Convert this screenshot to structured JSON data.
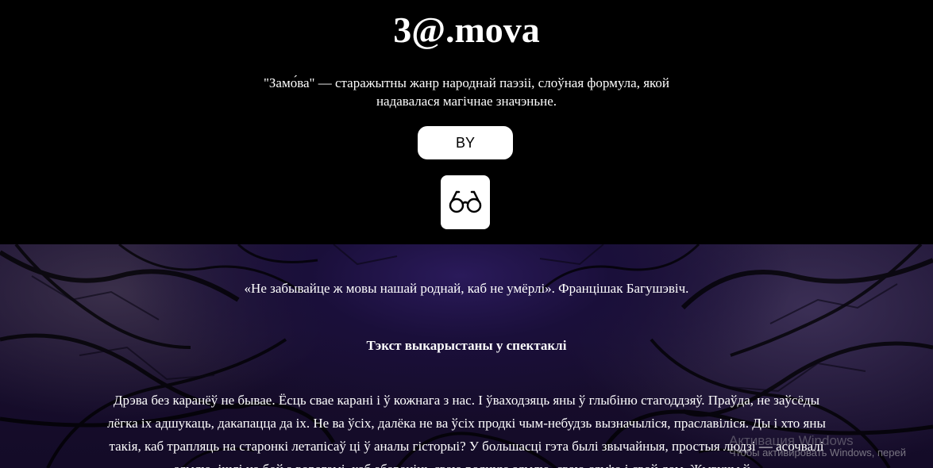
{
  "header": {
    "title": "3@.mova",
    "tagline_line1": "\"Замо́ва\" — старажытны жанр народнай паэзіі, слоўная формула, якой",
    "tagline_line2": "надавалася магічнае значэньне.",
    "lang_button_label": "BY",
    "glasses_icon": "glasses-icon"
  },
  "main": {
    "quote": "«Не забывайце ж мовы нашай роднай, каб не умёрлі». Францішак Багушэвіч.",
    "section_heading": "Тэкст выкарыстаны у спектаклі",
    "paragraph_lines": [
      "Дрэва без каранёў не бывае. Ёсць свае карані і ў кожнага з нас. І ўваходзяць яны ў глыбіню стагоддзяў. Праўда, не заўсёды",
      "лёгка іх адшукаць, дакапацца да іх. Не ва ўсіх, далёка не ва ўсіх продкі чым-небудзь вызначыліся, праславіліся. Ды і хто яны",
      "такія, каб трапляць на старонкі летапісаў ці ў аналы гісторыі? У большасці гэта былі звычайныя, простыя людзі — асочвалі",
      "зямлю, ішлі на бой з ворагамі, каб абараніць сваю родную зямлю, сваю сям'ю і свой дом. Жывучы ў..."
    ]
  },
  "system": {
    "watermark_title": "Активация Windows",
    "watermark_text": "Чтобы активировать Windows, перей"
  },
  "colors": {
    "background": "#000000",
    "button_bg": "#ffffff",
    "text": "#ffffff"
  }
}
